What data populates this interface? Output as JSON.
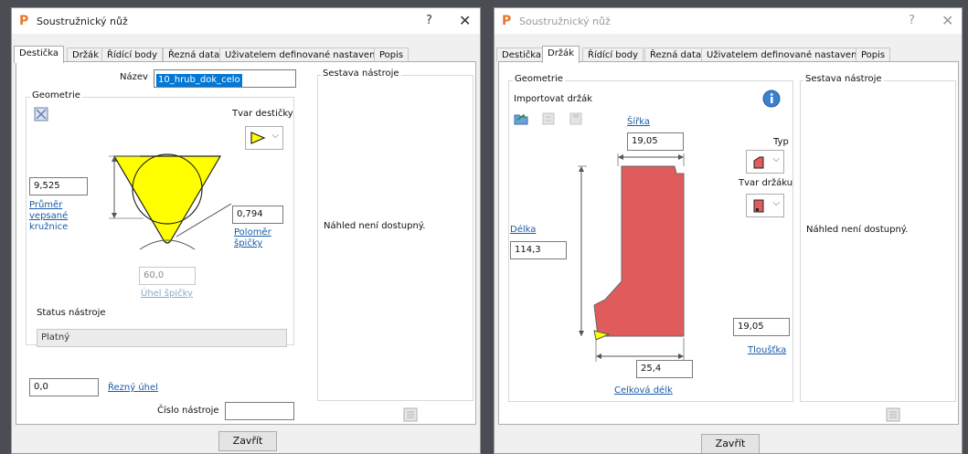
{
  "window1": {
    "title": "Soustružnický nůž",
    "help": "?",
    "close": "✕",
    "tabs": [
      "Destička",
      "Držák",
      "Řídící body",
      "Řezná data",
      "Uživatelem definované nastavení",
      "Popis"
    ],
    "name_label": "Název",
    "name_value": "10_hrub_dok_celo",
    "geometry_label": "Geometrie",
    "insert_shape_label": "Tvar destičky",
    "diameter_value": "9,525",
    "diameter_link": [
      "Průměr",
      "vepsané",
      "kružnice"
    ],
    "corner_radius_value": "0,794",
    "corner_radius_link": [
      "Poloměr",
      "špičky"
    ],
    "angle_value": "60,0",
    "angle_link": "Úhel špičky",
    "tool_status_label": "Status nástroje",
    "tool_status_value": "Platný",
    "cutting_angle_value": "0,0",
    "cutting_angle_link": "Řezný úhel",
    "tool_number_label": "Číslo nástroje",
    "tool_number_value": "",
    "assembly_label": "Sestava nástroje",
    "preview_text": "Náhled není dostupný.",
    "close_button": "Zavřít"
  },
  "window2": {
    "title": "Soustružnický nůž",
    "help": "?",
    "close": "✕",
    "tabs": [
      "Destička",
      "Držák",
      "Řídící body",
      "Řezná data",
      "Uživatelem definované nastavení",
      "Popis"
    ],
    "geometry_label": "Geometrie",
    "import_label": "Importovat držák",
    "width_link": "Šířka",
    "width_value": "19,05",
    "type_label": "Typ",
    "holder_shape_label": "Tvar držáku",
    "length_link": "Délka",
    "length_value": "114,3",
    "thickness_value": "19,05",
    "thickness_link": "Tloušťka",
    "overall_value": "25,4",
    "overall_link": "Celková délk",
    "assembly_label": "Sestava nástroje",
    "preview_text": "Náhled není dostupný.",
    "close_button": "Zavřít"
  },
  "colors": {
    "insert_yellow": "#ffff00",
    "holder_red": "#e05c5c",
    "link_blue": "#1a5ca8",
    "selection_blue": "#0078d7"
  }
}
